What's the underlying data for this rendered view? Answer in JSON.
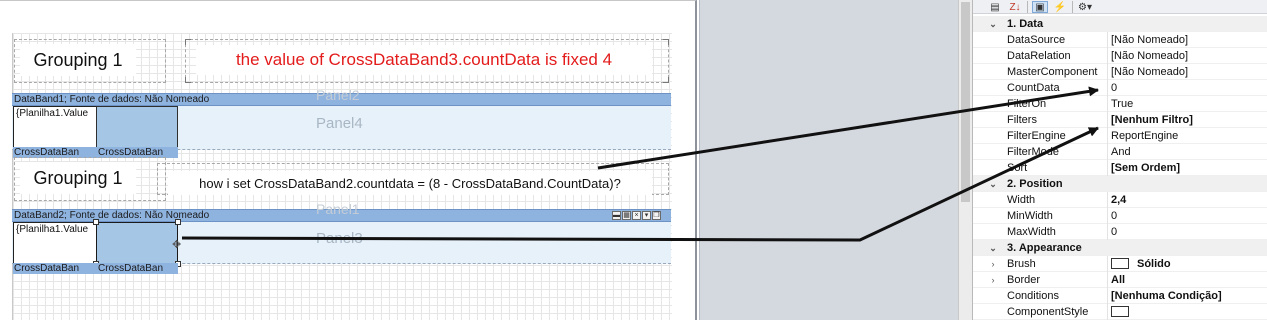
{
  "designer": {
    "grouping1_top": "Grouping 1",
    "grouping1_bottom": "Grouping 1",
    "note_red": "the value of CrossDataBand3.countData is fixed 4",
    "note_question": "how i set CrossDataBand2.countdata = (8 - CrossDataBand.CountData)?",
    "band1_header": "DataBand1; Fonte de dados: Não Nomeado",
    "band2_header": "DataBand2; Fonte de dados: Não Nomeado",
    "panel4": "Panel4",
    "panel3": "Panel3",
    "ghost_panel_top": "Panel2",
    "ghost_panel_bottom": "Panel1",
    "value_text_1": "{Planilha1.Value",
    "value_text_2": "{Planilha1.Value",
    "cross_footer_1a": "CrossDataBan",
    "cross_footer_1b": "CrossDataBan",
    "cross_footer_2a": "CrossDataBan",
    "cross_footer_2b": "CrossDataBan",
    "accent_red": "#e31b1b"
  },
  "toolbar": {
    "categorized_icon": "categorized-icon",
    "az_sort_label": "Z↓",
    "properties_icon": "properties-icon",
    "events_icon": "lightning-icon",
    "settings_label": "⚙▾"
  },
  "properties": {
    "cat_data": "1. Data",
    "datasource_name": "DataSource",
    "datasource_value": "[Não Nomeado]",
    "datarelation_name": "DataRelation",
    "datarelation_value": "[Não Nomeado]",
    "mastercomponent_name": "MasterComponent",
    "mastercomponent_value": "[Não Nomeado]",
    "countdata_name": "CountData",
    "countdata_value": "0",
    "filteron_name": "FilterOn",
    "filteron_value": "True",
    "filters_name": "Filters",
    "filters_value": "[Nenhum Filtro]",
    "filterengine_name": "FilterEngine",
    "filterengine_value": "ReportEngine",
    "filtermode_name": "FilterMode",
    "filtermode_value": "And",
    "sort_name": "Sort",
    "sort_value": "[Sem Ordem]",
    "cat_position": "2. Position",
    "width_name": "Width",
    "width_value": "2,4",
    "minwidth_name": "MinWidth",
    "minwidth_value": "0",
    "maxwidth_name": "MaxWidth",
    "maxwidth_value": "0",
    "cat_appearance": "3. Appearance",
    "brush_name": "Brush",
    "brush_value": "Sólido",
    "border_name": "Border",
    "border_value": "All",
    "conditions_name": "Conditions",
    "conditions_value": "[Nenhuma Condição]",
    "componentstyle_name": "ComponentStyle",
    "componentstyle_value": ""
  }
}
